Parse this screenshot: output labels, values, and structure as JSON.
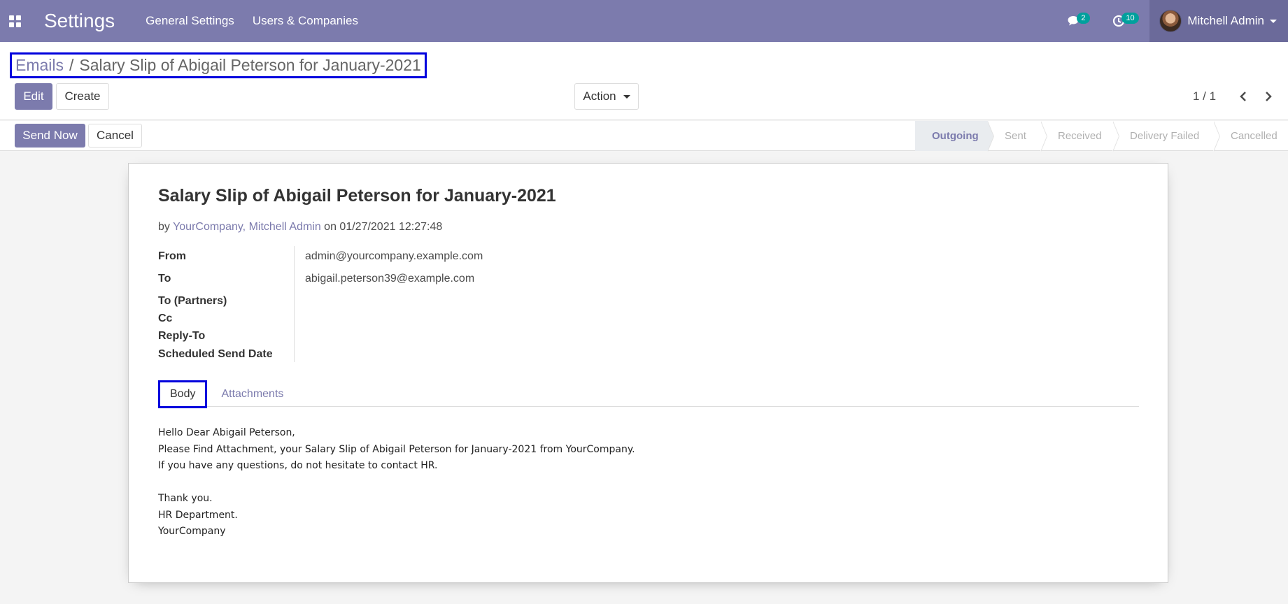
{
  "navbar": {
    "app_title": "Settings",
    "menu": [
      "General Settings",
      "Users & Companies"
    ],
    "messages_count": "2",
    "activities_count": "10",
    "user_name": "Mitchell Admin"
  },
  "breadcrumb": {
    "parent": "Emails",
    "separator": "/",
    "current": "Salary Slip of Abigail Peterson for January-2021"
  },
  "buttons": {
    "edit": "Edit",
    "create": "Create",
    "action": "Action",
    "send_now": "Send Now",
    "cancel": "Cancel"
  },
  "pager": {
    "value": "1 / 1"
  },
  "statusbar": {
    "steps": [
      "Outgoing",
      "Sent",
      "Received",
      "Delivery Failed",
      "Cancelled"
    ],
    "active": "Outgoing"
  },
  "email": {
    "subject": "Salary Slip of Abigail Peterson for January-2021",
    "by_prefix": "by",
    "authors": "YourCompany, Mitchell Admin",
    "on_prefix": "on",
    "date": "01/27/2021 12:27:48",
    "fields": [
      {
        "label": "From",
        "value": "admin@yourcompany.example.com"
      },
      {
        "label": "To",
        "value": "abigail.peterson39@example.com"
      },
      {
        "label": "To (Partners)",
        "value": ""
      },
      {
        "label": "Cc",
        "value": ""
      },
      {
        "label": "Reply-To",
        "value": ""
      },
      {
        "label": "Scheduled Send Date",
        "value": ""
      }
    ],
    "tabs": [
      "Body",
      "Attachments"
    ],
    "body_lines": [
      "Hello Dear Abigail Peterson,",
      "Please Find Attachment, your Salary Slip of Abigail Peterson for January-2021 from YourCompany.",
      "If you have any questions, do not hesitate to contact HR.",
      "",
      "Thank you.",
      "HR Department.",
      "YourCompany"
    ]
  },
  "colors": {
    "brand": "#7c7bad",
    "badge": "#00a09d",
    "highlight_box": "#0000dd"
  }
}
